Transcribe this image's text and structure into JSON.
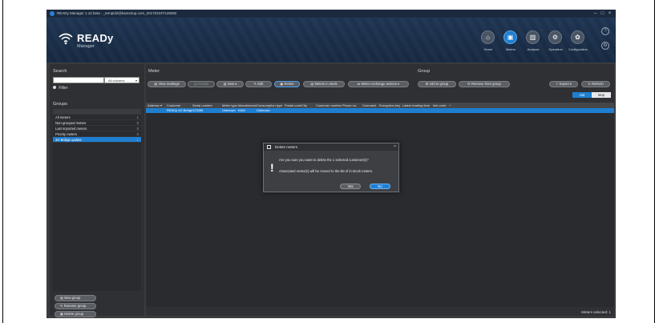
{
  "window": {
    "title": "READy Manager 1.12 beta - _tempid2@kamstrup.com_20170224T125082",
    "controls": [
      "–",
      "□",
      "×"
    ]
  },
  "logo": {
    "title": "READy",
    "subtitle": "Manager"
  },
  "nav": {
    "items": [
      {
        "label": "Home",
        "icon": "home-icon",
        "glyph": "⌂"
      },
      {
        "label": "Meters",
        "icon": "meters-icon",
        "glyph": "▣"
      },
      {
        "label": "Analysis",
        "icon": "analysis-icon",
        "glyph": "▥"
      },
      {
        "label": "Operation",
        "icon": "operation-icon",
        "glyph": "⚙"
      },
      {
        "label": "Configuration",
        "icon": "configuration-icon",
        "glyph": "✿"
      }
    ],
    "help": "?",
    "settings": "⚙"
  },
  "search": {
    "title": "Search",
    "value": "",
    "column_select": "All columns",
    "filter_label": "Filter"
  },
  "groups": {
    "title": "Groups",
    "items": [
      {
        "label": "All meters",
        "count": "1"
      },
      {
        "label": "Non-grouped meters",
        "count": "0"
      },
      {
        "label": "Last imported meters",
        "count": "0"
      },
      {
        "label": "Priority meters",
        "count": "0"
      },
      {
        "label": "4G Bridge update",
        "count": "1"
      }
    ],
    "buttons": {
      "new": "New group",
      "rename": "Rename group",
      "delete": "Delete group"
    }
  },
  "meter_section": {
    "title": "Meter",
    "buttons": {
      "view_readings": "View readings",
      "details": "Details",
      "new": "New",
      "edit": "Edit",
      "delete": "Delete",
      "meters_in_stock": "Meters in stock",
      "meter_exchange": "Meter exchange actions"
    }
  },
  "group_section": {
    "title": "Group",
    "buttons": {
      "add_to_group": "Add to group",
      "remove_from_group": "Remove from group"
    }
  },
  "export": {
    "label": "Export",
    "refresh": "Refresh"
  },
  "view_tabs": {
    "list": "List",
    "map": "Map"
  },
  "grid": {
    "columns": [
      "Address",
      "Customer",
      "Serial number",
      "Meter type",
      "Manufacturer",
      "Consumption type",
      "Postal code",
      "City",
      "Customer number",
      "Phone no.",
      "Comment",
      "Encryption key",
      "Latest reading time",
      "Info code",
      "+"
    ],
    "rows": [
      {
        "address": "",
        "customer": "READy 4G Bridge",
        "serial": "123456",
        "meter_type": "Unknown",
        "manufacturer": "KAM",
        "consumption_type": "Unknown"
      }
    ]
  },
  "status": {
    "meters_selected": "Meters selected: 1"
  },
  "dialog": {
    "title": "Delete meters",
    "message1": "Are you sure you want to delete the 1 selected customer(s)?",
    "message2": "Associated meter(s) will be moved to the list of in-stock meters.",
    "yes": "Yes",
    "no": "No",
    "close": "×",
    "icon": "!"
  },
  "colors": {
    "accent": "#1e7fd1",
    "header": "#1a2e48",
    "panel": "#2f3033"
  }
}
